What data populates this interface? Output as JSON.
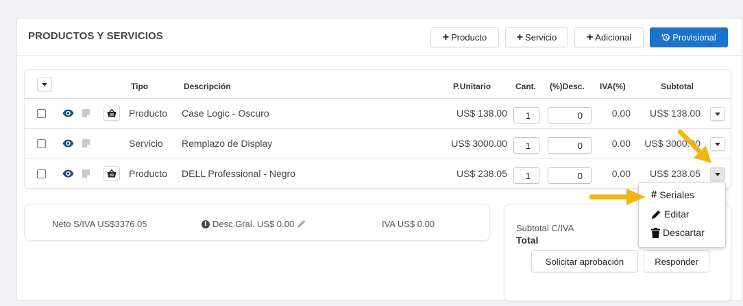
{
  "header": {
    "title": "PRODUCTOS Y SERVICIOS",
    "buttons": {
      "producto": "Producto",
      "servicio": "Servicio",
      "adicional": "Adicional",
      "provisional": "Provisional"
    }
  },
  "table": {
    "columns": {
      "tipo": "Tipo",
      "descripcion": "Descripción",
      "unitario": "P.Unitario",
      "cant": "Cant.",
      "desc": "(%)Desc.",
      "iva": "IVA(%)",
      "subtotal": "Subtotal"
    },
    "rows": [
      {
        "tipo": "Producto",
        "descripcion": "Case Logic - Oscuro",
        "unitario": "US$ 138.00",
        "cant": "1",
        "desc": "0",
        "iva": "0.00",
        "subtotal": "US$ 138.00"
      },
      {
        "tipo": "Servicio",
        "descripcion": "Remplazo de Display",
        "unitario": "US$ 3000.00",
        "cant": "1",
        "desc": "0",
        "iva": "0.00",
        "subtotal": "US$ 3000.00"
      },
      {
        "tipo": "Producto",
        "descripcion": "DELL Professional - Negro",
        "unitario": "US$ 238.05",
        "cant": "1",
        "desc": "0",
        "iva": "0.00",
        "subtotal": "US$ 238.05"
      }
    ]
  },
  "summary": {
    "neto": "Neto S/IVA US$3376.05",
    "desc_gral": "Desc.Gral. US$ 0.00",
    "iva": "IVA US$ 0.00"
  },
  "totals": {
    "subtotal_label": "Subtotal C/IVA",
    "total_label": "Total",
    "solicitar": "Solicitar aprobación",
    "responder": "Responder"
  },
  "menu": {
    "seriales": "Seriales",
    "editar": "Editar",
    "descartar": "Descartar"
  },
  "colors": {
    "primary": "#1a73c9",
    "arrow": "#f4b416"
  }
}
